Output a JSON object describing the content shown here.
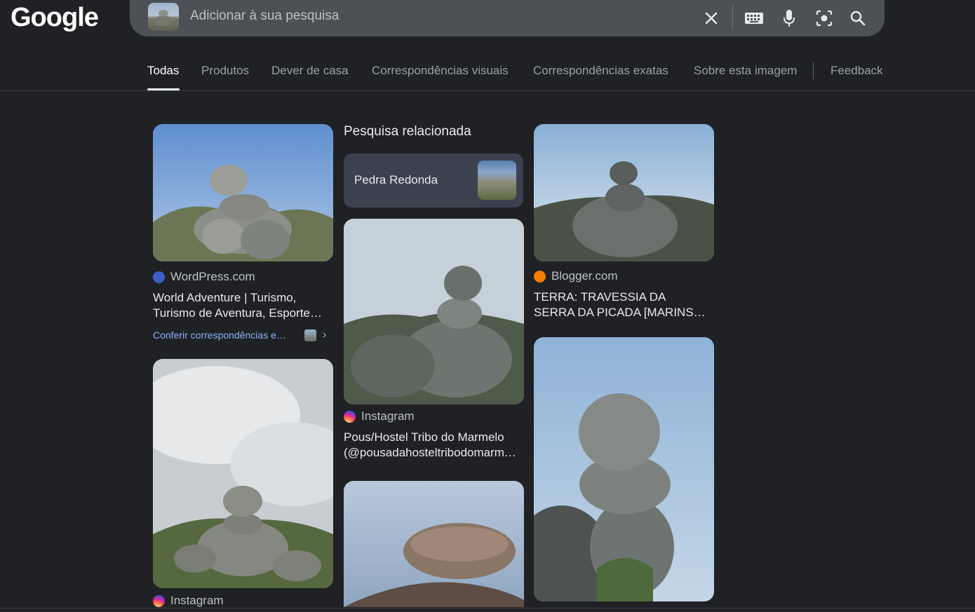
{
  "header": {
    "logo": "Google",
    "search_placeholder": "Adicionar à sua pesquisa",
    "icons": [
      "close-icon",
      "keyboard-icon",
      "microphone-icon",
      "lens-icon",
      "search-icon"
    ]
  },
  "tabs": [
    {
      "label": "Todas",
      "active": true
    },
    {
      "label": "Produtos"
    },
    {
      "label": "Dever de casa"
    },
    {
      "label": "Correspondências visuais"
    },
    {
      "label": "Correspondências exatas"
    },
    {
      "label": "Sobre esta imagem"
    },
    {
      "label": "Feedback"
    }
  ],
  "related": {
    "heading": "Pesquisa relacionada",
    "chip_label": "Pedra Redonda"
  },
  "results": [
    {
      "source": "WordPress.com",
      "title_line1": "World Adventure | Turismo,",
      "title_line2": "Turismo de Aventura, Esporte…",
      "link": "Conferir correspondências e…"
    },
    {
      "source": "Instagram",
      "title_line1": "Pous/Hostel Tribo do Marmelo",
      "title_line2": "(@pousadahosteltribodomarm…"
    },
    {
      "source": "Blogger.com",
      "title_line1": "TERRA: TRAVESSIA DA",
      "title_line2": "SERRA DA PICADA [MARINS…"
    },
    {
      "source": "Instagram"
    }
  ],
  "colors": {
    "background": "#202124",
    "link": "#8ab4f8",
    "chip": "#3c4150"
  }
}
